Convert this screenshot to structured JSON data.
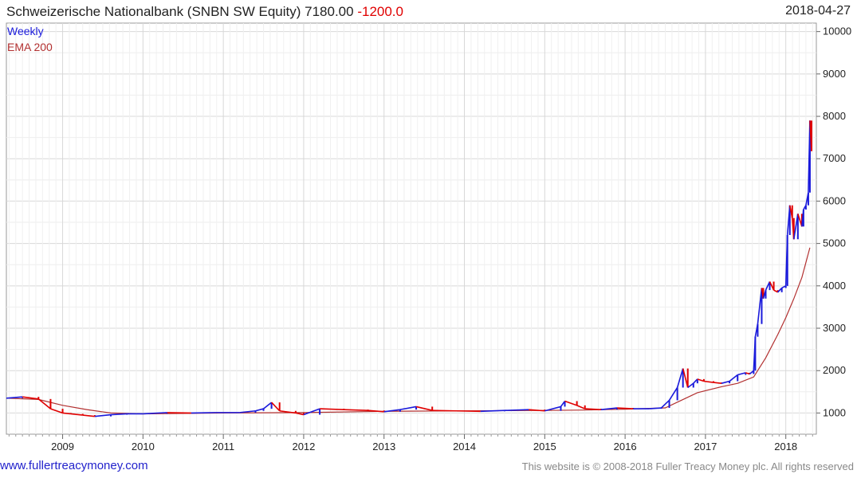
{
  "header": {
    "title": "Schweizerische Nationalbank (SNBN SW Equity) 7180.00",
    "change": "-1200.0",
    "date": "2018-04-27"
  },
  "legend": {
    "series1": "Weekly",
    "series2": "EMA 200"
  },
  "footer": {
    "site": "www.fullertreacymoney.com",
    "copyright": "This website is © 2008-2018 Fuller Treacy Money plc. All rights reserved"
  },
  "colors": {
    "up": "#1a1adb",
    "down": "#e00000",
    "ema": "#b23030",
    "grid": "#d8d8d8"
  },
  "chart_data": {
    "type": "line",
    "title": "Schweizerische Nationalbank (SNBN SW Equity) 7180.00 -1200.0",
    "ylim": [
      500,
      10200
    ],
    "xlim": [
      2008.3,
      2018.38
    ],
    "y_ticks": [
      "1000",
      "2000",
      "3000",
      "4000",
      "5000",
      "6000",
      "7000",
      "8000",
      "9000",
      "10000"
    ],
    "y_tick_values": [
      1000,
      2000,
      3000,
      4000,
      5000,
      6000,
      7000,
      8000,
      9000,
      10000
    ],
    "x_ticks": [
      "2009",
      "2010",
      "2011",
      "2012",
      "2013",
      "2014",
      "2015",
      "2016",
      "2017",
      "2018"
    ],
    "x_tick_values": [
      2009,
      2010,
      2011,
      2012,
      2013,
      2014,
      2015,
      2016,
      2017,
      2018
    ],
    "grid": true,
    "series": [
      {
        "name": "Weekly",
        "x": [
          2008.3,
          2008.5,
          2008.7,
          2008.85,
          2009.0,
          2009.1,
          2009.25,
          2009.4,
          2009.6,
          2009.8,
          2010.0,
          2010.3,
          2010.6,
          2010.9,
          2011.2,
          2011.4,
          2011.5,
          2011.6,
          2011.7,
          2011.9,
          2012.0,
          2012.2,
          2012.5,
          2012.8,
          2013.0,
          2013.2,
          2013.4,
          2013.6,
          2013.9,
          2014.2,
          2014.5,
          2014.8,
          2015.0,
          2015.2,
          2015.25,
          2015.4,
          2015.5,
          2015.7,
          2015.9,
          2016.1,
          2016.3,
          2016.45,
          2016.55,
          2016.65,
          2016.72,
          2016.78,
          2016.85,
          2016.9,
          2016.98,
          2017.1,
          2017.2,
          2017.3,
          2017.4,
          2017.5,
          2017.55,
          2017.6,
          2017.62,
          2017.65,
          2017.7,
          2017.72,
          2017.75,
          2017.8,
          2017.85,
          2017.9,
          2017.95,
          2018.0,
          2018.02,
          2018.05,
          2018.08,
          2018.1,
          2018.15,
          2018.2,
          2018.22,
          2018.25,
          2018.28,
          2018.3,
          2018.32
        ],
        "values": [
          1350,
          1380,
          1330,
          1100,
          1000,
          980,
          950,
          920,
          960,
          980,
          980,
          1010,
          1000,
          1010,
          1010,
          1050,
          1100,
          1250,
          1050,
          1000,
          960,
          1100,
          1080,
          1060,
          1030,
          1080,
          1150,
          1060,
          1050,
          1040,
          1060,
          1080,
          1050,
          1150,
          1280,
          1180,
          1100,
          1080,
          1120,
          1100,
          1100,
          1120,
          1300,
          1600,
          2050,
          1600,
          1700,
          1800,
          1750,
          1720,
          1700,
          1750,
          1900,
          1950,
          1920,
          2000,
          2800,
          3100,
          3950,
          3700,
          3900,
          4100,
          3900,
          3850,
          3950,
          4000,
          5200,
          5900,
          5600,
          5100,
          5700,
          5400,
          5800,
          5900,
          6200,
          7900,
          7180
        ]
      },
      {
        "name": "EMA 200",
        "x": [
          2008.3,
          2008.7,
          2009.0,
          2009.3,
          2009.6,
          2010.0,
          2011.0,
          2012.0,
          2013.0,
          2014.0,
          2015.0,
          2015.5,
          2016.0,
          2016.5,
          2016.7,
          2016.9,
          2017.2,
          2017.4,
          2017.6,
          2017.75,
          2017.9,
          2018.0,
          2018.1,
          2018.2,
          2018.3
        ],
        "values": [
          1350,
          1320,
          1180,
          1080,
          1000,
          980,
          1000,
          1010,
          1040,
          1050,
          1060,
          1070,
          1090,
          1120,
          1300,
          1480,
          1620,
          1700,
          1850,
          2300,
          2850,
          3250,
          3700,
          4200,
          4900
        ]
      }
    ]
  }
}
